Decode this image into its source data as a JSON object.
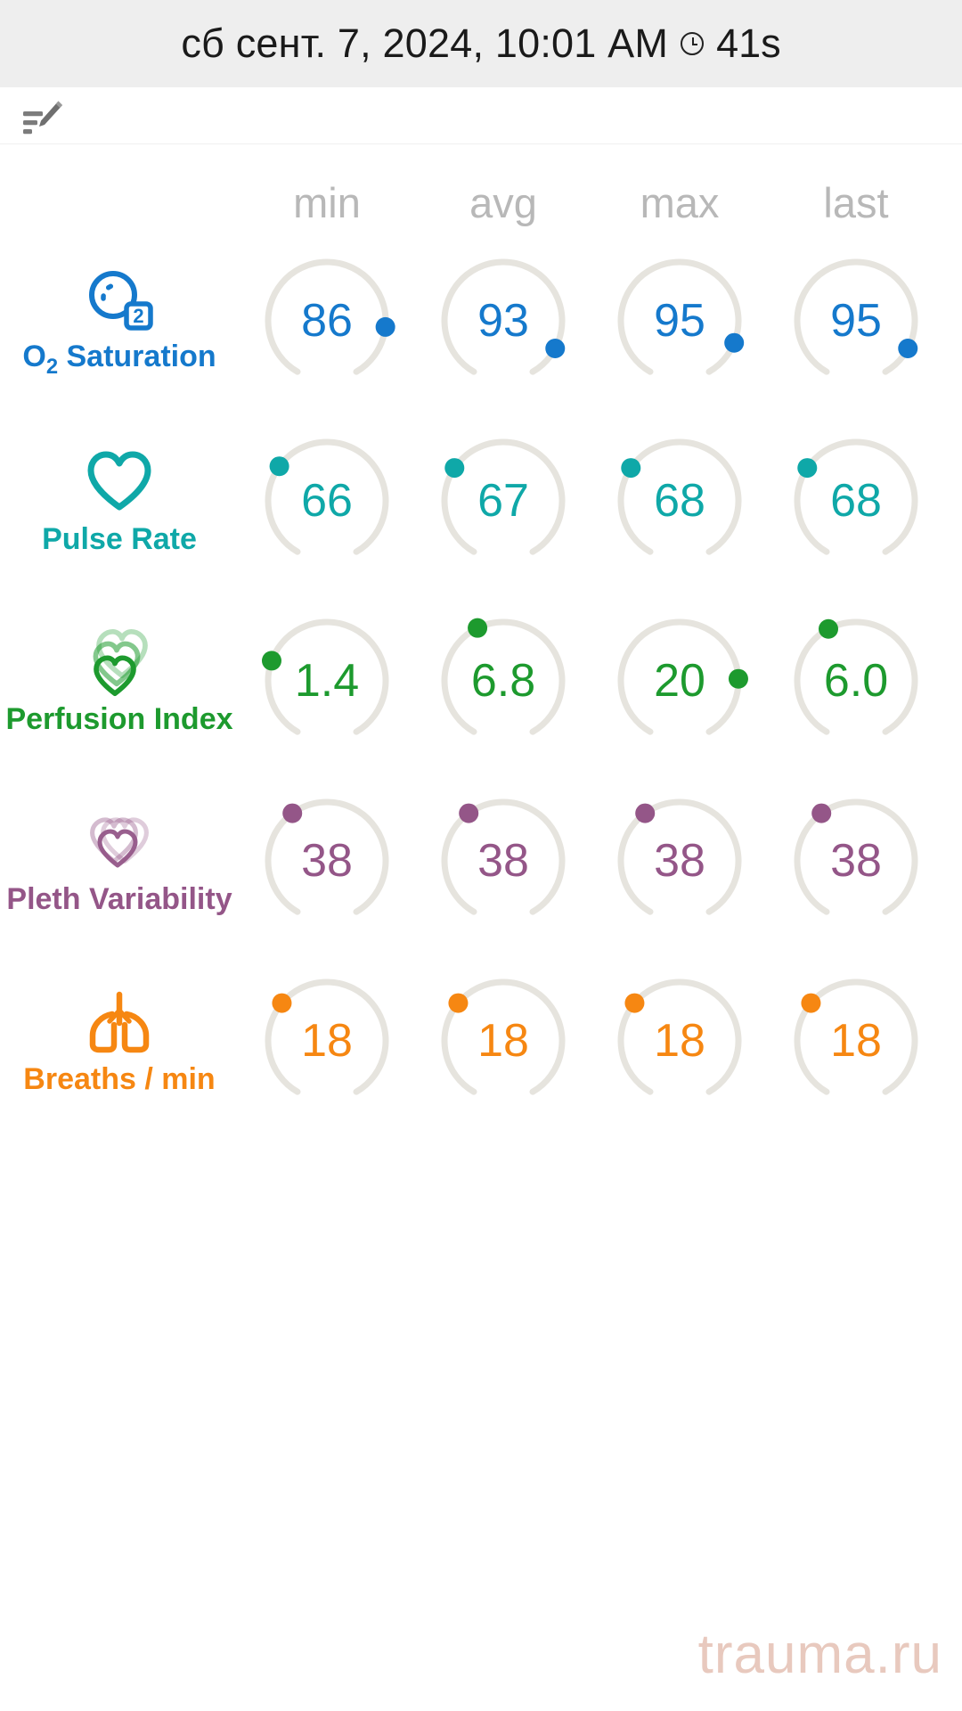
{
  "header": {
    "datetime_text": "сб сент. 7, 2024, 10:01 AM",
    "clock_icon": "clock-icon",
    "duration": "41s"
  },
  "toolbar": {
    "edit_note_icon": "edit-note-icon"
  },
  "columns": [
    "min",
    "avg",
    "max",
    "last"
  ],
  "metrics": [
    {
      "label_html": "O<sub>2</sub> Saturation",
      "label_plain": "O2 Saturation",
      "icon": "oxygen-molecule-icon",
      "color": "#1579cc",
      "values": [
        "86",
        "93",
        "95",
        "95"
      ],
      "dot_angles": [
        96,
        118,
        112,
        118
      ]
    },
    {
      "label_html": "Pulse Rate",
      "label_plain": "Pulse Rate",
      "icon": "heart-icon",
      "color": "#0fa8a8",
      "values": [
        "66",
        "67",
        "68",
        "68"
      ],
      "dot_angles": [
        -54,
        -56,
        -56,
        -56
      ]
    },
    {
      "label_html": "Perfusion Index",
      "label_plain": "Perfusion Index",
      "icon": "nested-hearts-icon",
      "color": "#1d9a2e",
      "values": [
        "1.4",
        "6.8",
        "20",
        "6.0"
      ],
      "dot_angles": [
        -70,
        -26,
        88,
        -28
      ]
    },
    {
      "label_html": "Pleth Variability",
      "label_plain": "Pleth Variability",
      "icon": "double-heart-outline-icon",
      "color": "#945688",
      "values": [
        "38",
        "38",
        "38",
        "38"
      ],
      "dot_angles": [
        -36,
        -36,
        -36,
        -36
      ]
    },
    {
      "label_html": "Breaths / min",
      "label_plain": "Breaths / min",
      "icon": "lungs-icon",
      "color": "#f68712",
      "values": [
        "18",
        "18",
        "18",
        "18"
      ],
      "dot_angles": [
        -50,
        -50,
        -50,
        -50
      ]
    }
  ],
  "watermark": "trauma.ru",
  "palette": {
    "titlebar_bg": "#eeeeee",
    "gauge_track": "#e6e4de",
    "column_header": "#b8b8b8",
    "watermark": "#e8c9be"
  }
}
